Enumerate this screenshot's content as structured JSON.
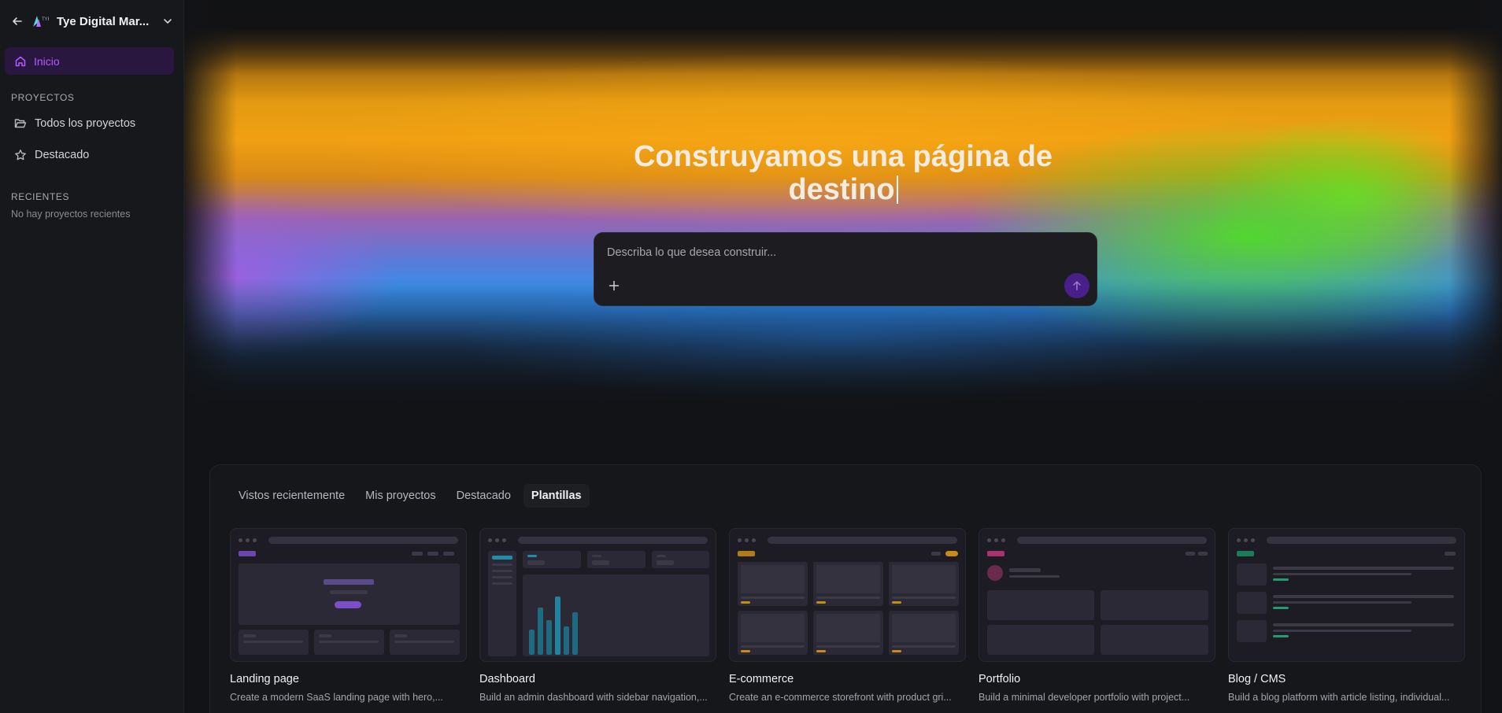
{
  "sidebar": {
    "workspace_name": "Tye Digital Mar...",
    "home_label": "Inicio",
    "projects_section": "PROYECTOS",
    "projects_items": [
      {
        "label": "Todos los proyectos",
        "icon": "folder-open-icon"
      },
      {
        "label": "Destacado",
        "icon": "star-icon"
      }
    ],
    "recent_section": "RECIENTES",
    "recent_empty": "No hay proyectos recientes"
  },
  "hero": {
    "headline_line1": "Construyamos una página de",
    "headline_line2": "destino",
    "prompt_placeholder": "Describa lo que desea construir..."
  },
  "tabs": [
    "Vistos recientemente",
    "Mis proyectos",
    "Destacado",
    "Plantillas"
  ],
  "active_tab": "Plantillas",
  "templates": [
    {
      "title": "Landing page",
      "desc": "Create a modern SaaS landing page with hero,...",
      "accent": "#7b4fc9"
    },
    {
      "title": "Dashboard",
      "desc": "Build an admin dashboard with sidebar navigation,...",
      "accent": "#1f8fa8"
    },
    {
      "title": "E-commerce",
      "desc": "Create an e-commerce storefront with product gri...",
      "accent": "#c98a1a"
    },
    {
      "title": "Portfolio",
      "desc": "Build a minimal developer portfolio with project...",
      "accent": "#c43b7e"
    },
    {
      "title": "Blog / CMS",
      "desc": "Build a blog platform with article listing, individual...",
      "accent": "#1f9d6d"
    }
  ],
  "colors": {
    "brand_purple": "#b05cff",
    "send_button": "#4b1f8a"
  }
}
